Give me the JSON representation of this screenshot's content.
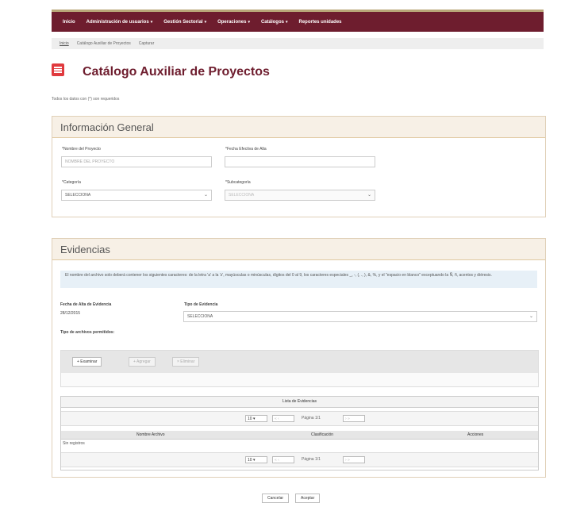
{
  "nav": {
    "items": [
      {
        "label": "Inicio",
        "caret": false
      },
      {
        "label": "Administración de usuarios",
        "caret": true
      },
      {
        "label": "Gestión Sectorial",
        "caret": true
      },
      {
        "label": "Operaciones",
        "caret": true
      },
      {
        "label": "Catálogos",
        "caret": true
      },
      {
        "label": "Reportes unidades",
        "caret": false
      }
    ],
    "bar_color": "#6e1d2e"
  },
  "breadcrumb": {
    "home": "Inicio",
    "section": "Catálogo Auxiliar de Proyectos",
    "current": "Capturar"
  },
  "page": {
    "title": "Catálogo Auxiliar de Proyectos",
    "note": "Todos los datos con (*) son requeridos"
  },
  "general": {
    "heading": "Información General",
    "name_label": "*Nombre del Proyecto",
    "name_placeholder": "NOMBRE DEL PROYECTO",
    "date_label": "*Fecha Efectiva de Alta",
    "date_value": "",
    "category_label": "*Categoría",
    "category_value": "SELECCIONA",
    "subcategory_label": "*Subcategoría",
    "subcategory_value": "SELECCIONA"
  },
  "evidence": {
    "heading": "Evidencias",
    "info": "El nombre del archivo solo deberá contener los siguientes caracteres: de la letra 'a' a la 'z', mayúsculas o minúsculas, dígitos del 0 al 9, los caracteres especiales _, -, (, ., ), &, %, y el \"espacio en blanco\" exceptuando la Ñ, ñ, acentos y diéresis.",
    "date_label": "Fecha de Alta de Evidencia",
    "date_value": "28/12/2015",
    "type_label": "Tipo de Evidencia",
    "type_value": "SELECCIONA",
    "allowed_label": "Tipo de archivos permitidos:",
    "browse_label": "+ Examinar",
    "add_label": "+ Agregar",
    "remove_label": "× Eliminar"
  },
  "table": {
    "title": "Lista de Evidencias",
    "page_size": "10",
    "page_text": "Página 1/1",
    "columns": [
      "Nombre Archivo",
      "Clasificación",
      "Acciones"
    ],
    "empty_text": "Sin registros"
  },
  "footer": {
    "cancel": "Cancelar",
    "accept": "Aceptar"
  },
  "colors": {
    "accent": "#6e1d2e",
    "icon_red": "#e03a3e",
    "panel_head": "#f7f0e6"
  }
}
